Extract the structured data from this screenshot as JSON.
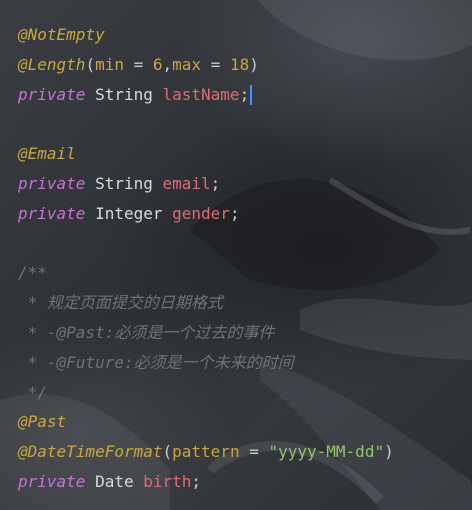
{
  "editor": {
    "lines": [
      {
        "tokens": [
          {
            "kind": "annotation",
            "text": "@NotEmpty"
          }
        ]
      },
      {
        "tokens": [
          {
            "kind": "annotation",
            "text": "@Length"
          },
          {
            "kind": "paren",
            "text": "("
          },
          {
            "kind": "param",
            "text": "min"
          },
          {
            "kind": "paren",
            "text": " = "
          },
          {
            "kind": "number",
            "text": "6"
          },
          {
            "kind": "paren",
            "text": ","
          },
          {
            "kind": "param",
            "text": "max"
          },
          {
            "kind": "paren",
            "text": " = "
          },
          {
            "kind": "number",
            "text": "18"
          },
          {
            "kind": "paren",
            "text": ")"
          }
        ]
      },
      {
        "tokens": [
          {
            "kind": "keyword",
            "text": "private"
          },
          {
            "kind": "type",
            "text": " String "
          },
          {
            "kind": "field",
            "text": "lastName"
          },
          {
            "kind": "paren",
            "text": ";"
          }
        ],
        "caret": true
      },
      {
        "tokens": []
      },
      {
        "tokens": [
          {
            "kind": "annotation",
            "text": "@Email"
          }
        ]
      },
      {
        "tokens": [
          {
            "kind": "keyword",
            "text": "private"
          },
          {
            "kind": "type",
            "text": " String "
          },
          {
            "kind": "field",
            "text": "email"
          },
          {
            "kind": "paren",
            "text": ";"
          }
        ]
      },
      {
        "tokens": [
          {
            "kind": "keyword",
            "text": "private"
          },
          {
            "kind": "type",
            "text": " Integer "
          },
          {
            "kind": "field",
            "text": "gender"
          },
          {
            "kind": "paren",
            "text": ";"
          }
        ]
      },
      {
        "tokens": []
      },
      {
        "tokens": [
          {
            "kind": "comment",
            "text": "/**"
          }
        ]
      },
      {
        "tokens": [
          {
            "kind": "comment",
            "text": " * 规定页面提交的日期格式"
          }
        ]
      },
      {
        "tokens": [
          {
            "kind": "comment",
            "text": " * -@Past:必须是一个过去的事件"
          }
        ]
      },
      {
        "tokens": [
          {
            "kind": "comment",
            "text": " * -@Future:必须是一个未来的时间"
          }
        ]
      },
      {
        "tokens": [
          {
            "kind": "comment",
            "text": " */"
          }
        ]
      },
      {
        "tokens": [
          {
            "kind": "annotation",
            "text": "@Past"
          }
        ]
      },
      {
        "tokens": [
          {
            "kind": "annotation",
            "text": "@DateTimeFormat"
          },
          {
            "kind": "paren",
            "text": "("
          },
          {
            "kind": "param",
            "text": "pattern"
          },
          {
            "kind": "paren",
            "text": " = "
          },
          {
            "kind": "string",
            "text": "\"yyyy-MM-dd\""
          },
          {
            "kind": "paren",
            "text": ")"
          }
        ]
      },
      {
        "tokens": [
          {
            "kind": "keyword",
            "text": "private"
          },
          {
            "kind": "type",
            "text": " Date "
          },
          {
            "kind": "field",
            "text": "birth"
          },
          {
            "kind": "paren",
            "text": ";"
          }
        ]
      }
    ]
  },
  "colors": {
    "annotation": "#c9a740",
    "keyword": "#c873d6",
    "field": "#e06b76",
    "string": "#94c36c",
    "comment": "#6e737a",
    "caret": "#4c8dff"
  }
}
